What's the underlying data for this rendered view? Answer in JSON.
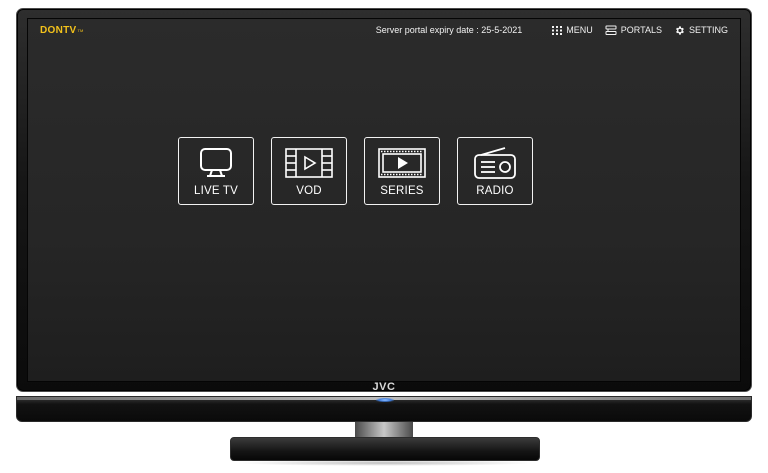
{
  "tv": {
    "brand": "JVC"
  },
  "app": {
    "logo": "DONTV",
    "logo_sub": "TM",
    "expiry_text": "Server portal expiry date : 25-5-2021",
    "nav": [
      {
        "label": "MENU",
        "icon": "grid-icon"
      },
      {
        "label": "PORTALS",
        "icon": "portals-icon"
      },
      {
        "label": "SETTING",
        "icon": "gear-icon"
      }
    ]
  },
  "tiles": [
    {
      "label": "LIVE TV",
      "icon": "tv-icon"
    },
    {
      "label": "VOD",
      "icon": "film-play-icon"
    },
    {
      "label": "SERIES",
      "icon": "series-play-icon"
    },
    {
      "label": "RADIO",
      "icon": "radio-icon"
    }
  ],
  "colors": {
    "accent_logo": "#f3c21b",
    "text": "#f2f2f2",
    "screen_bg": "#262626"
  }
}
